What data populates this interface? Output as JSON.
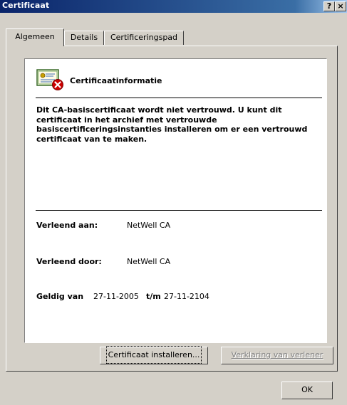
{
  "window": {
    "title": "Certificaat",
    "help_button": "?",
    "close_button": "×"
  },
  "tabs": [
    {
      "label": "Algemeen",
      "active": true
    },
    {
      "label": "Details",
      "active": false
    },
    {
      "label": "Certificeringspad",
      "active": false
    }
  ],
  "info": {
    "heading": "Certificaatinformatie",
    "icon": "certificate-error-icon",
    "message": "Dit CA-basiscertificaat wordt niet vertrouwd. U kunt dit certificaat in het archief met vertrouwde basiscertificeringsinstanties installeren om er een vertrouwd certificaat van te maken.",
    "issued_to_label": "Verleend aan:",
    "issued_to_value": "NetWell CA",
    "issued_by_label": "Verleend door:",
    "issued_by_value": "NetWell CA",
    "valid_from_label": "Geldig van",
    "valid_from_value": "27-11-2005",
    "valid_to_label": "t/m",
    "valid_to_value": "27-11-2104"
  },
  "buttons": {
    "install": "Certificaat installeren...",
    "issuer_statement": "Verklaring van verlener",
    "ok": "OK"
  },
  "colors": {
    "face": "#d4d0c8",
    "titlebar_start": "#0a246a",
    "titlebar_end": "#a6caf0",
    "error_red": "#cc0000"
  }
}
